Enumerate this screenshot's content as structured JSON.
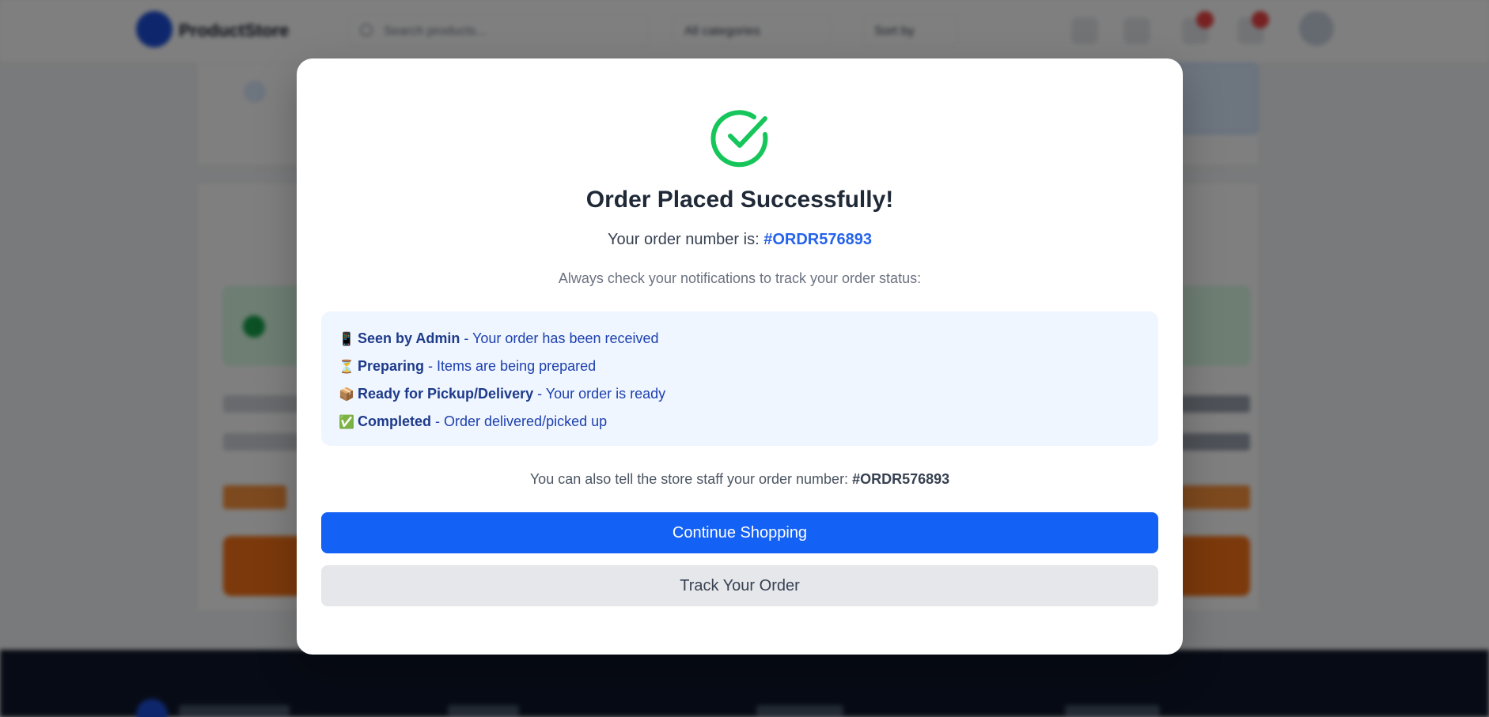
{
  "header": {
    "brand": "ProductStore",
    "search_placeholder": "Search products...",
    "category_select": "All categories",
    "sort_select": "Sort by"
  },
  "modal": {
    "icon": "check-circle-icon",
    "title": "Order Placed Successfully!",
    "order_prefix": "Your order number is:",
    "order_number": "#ORDR576893",
    "hint": "Always check your notifications to track your order status:",
    "statuses": [
      {
        "emoji": "📱",
        "label": "Seen by Admin",
        "desc": " - Your order has been received"
      },
      {
        "emoji": "⏳",
        "label": "Preparing",
        "desc": " - Items are being prepared"
      },
      {
        "emoji": "📦",
        "label": "Ready for Pickup/Delivery",
        "desc": " - Your order is ready"
      },
      {
        "emoji": "✅",
        "label": "Completed",
        "desc": " - Order delivered/picked up"
      }
    ],
    "staff_prefix": "You can also tell the store staff your order number:",
    "staff_number": "#ORDR576893",
    "continue_label": "Continue Shopping",
    "track_label": "Track Your Order"
  },
  "colors": {
    "accent": "#1461f5",
    "success": "#16a34a",
    "status_bg": "#eff6ff"
  }
}
